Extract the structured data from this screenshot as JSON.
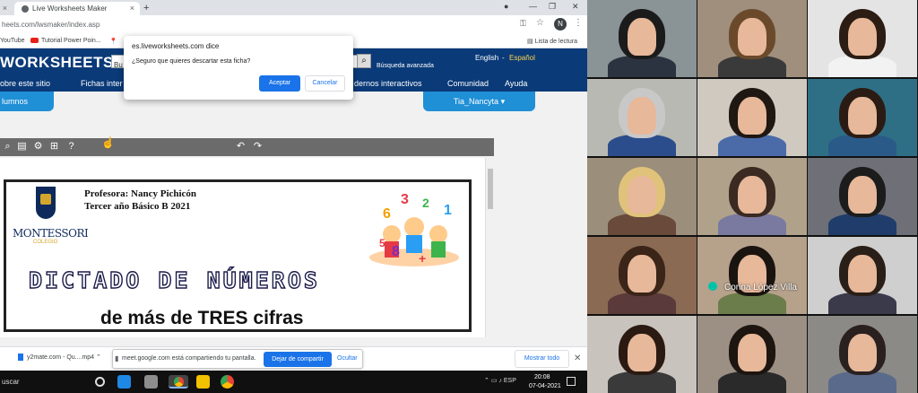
{
  "browser": {
    "tab_label": "Live Worksheets Maker",
    "url": "heets.com/lwsmaker/index.asp",
    "bookmarks": [
      "YouTube",
      "Tutorial Power Poin..."
    ],
    "reading_list": "Lista de lectura",
    "profile_initial": "N"
  },
  "site": {
    "logo": "WORKSHEETS",
    "search_placeholder": "Bu",
    "advanced_search": "Búsqueda avanzada",
    "lang_english": "English",
    "lang_sep": "-",
    "lang_spanish": "Español",
    "nav": [
      "obre este sitio",
      "Fichas inter",
      "dernos interactivos",
      "Comunidad",
      "Ayuda"
    ],
    "alumnos": "lumnos",
    "user": "Tia_Nancyta"
  },
  "dialog": {
    "title": "es.liveworksheets.com dice",
    "message": "¿Seguro que quieres descartar esta ficha?",
    "accept": "Aceptar",
    "cancel": "Cancelar"
  },
  "worksheet": {
    "teacher": "Profesora: Nancy Pichicón",
    "grade": "Tercer año Básico B 2021",
    "school": "MONTESSORI",
    "school_sub": "COLEGIO",
    "title": "DICTADO DE NÚMEROS",
    "subtitle": "de más de TRES cifras",
    "clipart_numbers": [
      "3",
      "6",
      "1",
      "2",
      "8",
      "5",
      "+"
    ]
  },
  "downloads": {
    "file": "y2mate.com - Qu....mp4",
    "share_message": "meet.google.com está compartiendo tu pantalla.",
    "stop_sharing": "Dejar de compartir",
    "hide": "Ocultar",
    "show_all": "Mostrar todo"
  },
  "taskbar": {
    "search": "uscar",
    "lang": "ESP",
    "time": "20:08",
    "date": "07-04-2021"
  },
  "video_grid": {
    "named_participant": "Corina López Villa"
  },
  "colors": {
    "site_header": "#0a3a78",
    "accent_blue": "#1f8fd6",
    "chrome_blue": "#1a73e8",
    "taskbar": "#101010"
  }
}
